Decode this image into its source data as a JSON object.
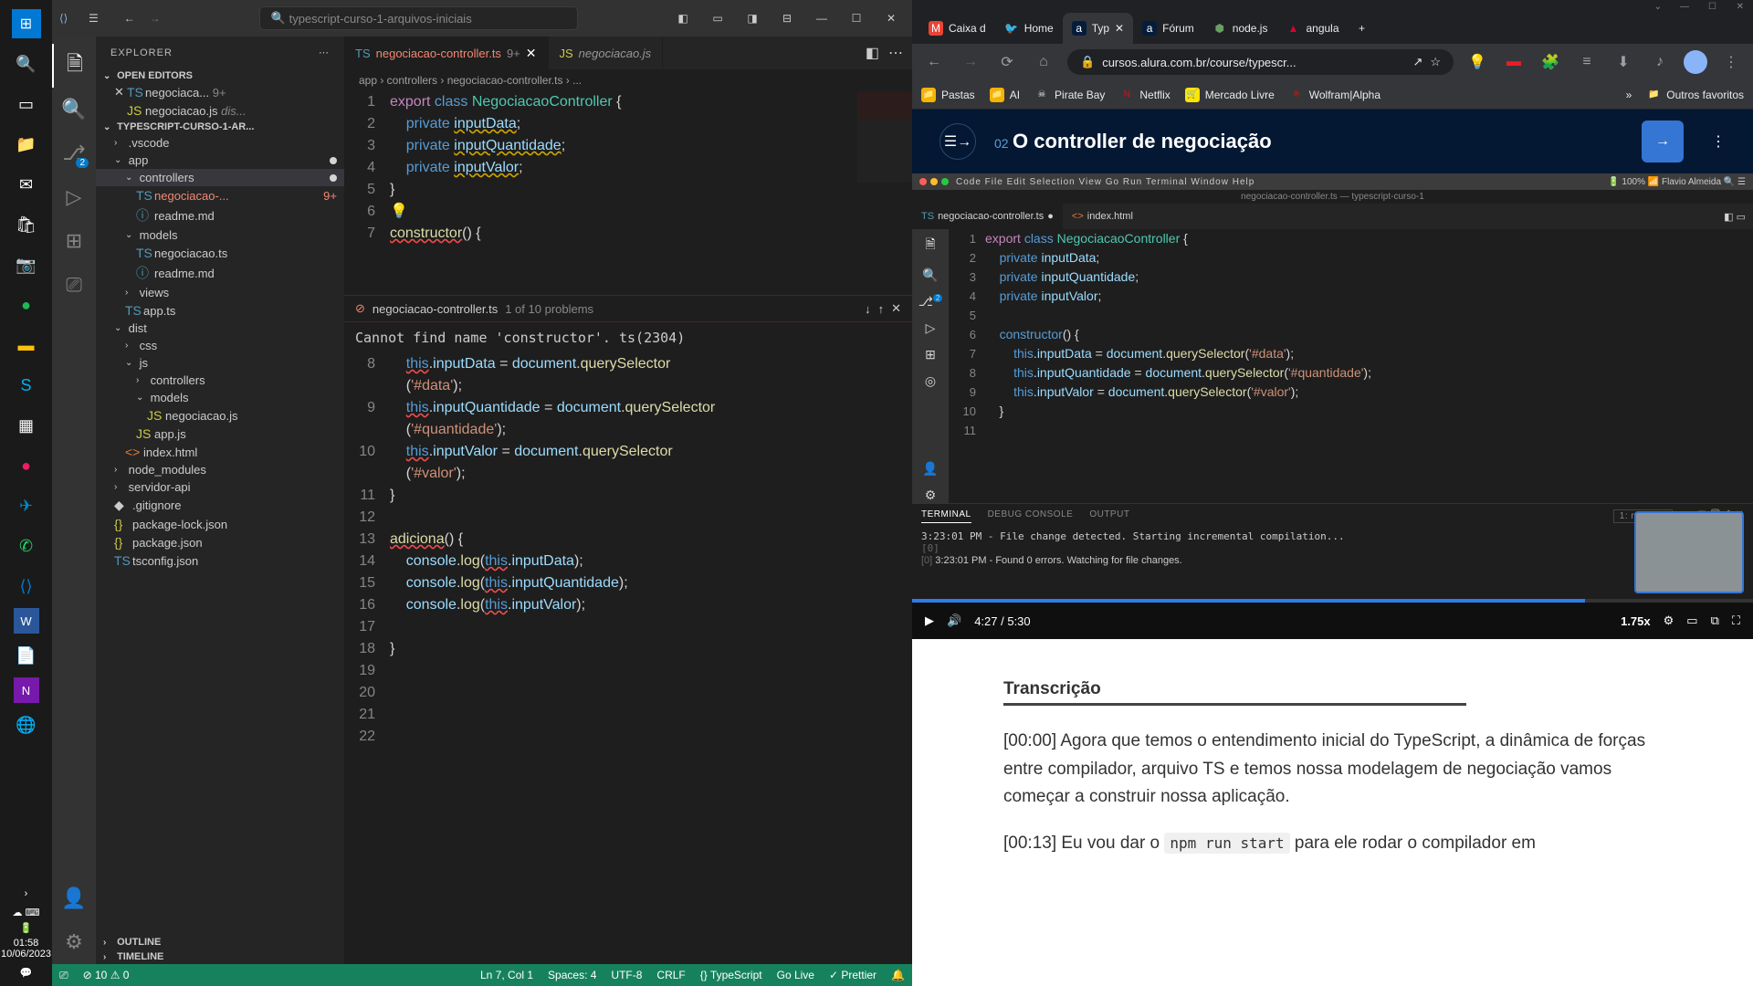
{
  "taskbar": {
    "time": "01:58",
    "date": "10/06/2023"
  },
  "vscode": {
    "titlebar_search": "typescript-curso-1-arquivos-iniciais",
    "explorer_label": "EXPLORER",
    "open_editors_label": "OPEN EDITORS",
    "workspace_label": "TYPESCRIPT-CURSO-1-AR...",
    "outline_label": "OUTLINE",
    "timeline_label": "TIMELINE",
    "editors": [
      {
        "name": "negociaca...",
        "badge": "9+",
        "icon": "TS"
      },
      {
        "name": "negociacao.js",
        "badge": "dis...",
        "icon": "JS"
      }
    ],
    "tree": {
      "vscode": ".vscode",
      "app": "app",
      "controllers": "controllers",
      "negociacao_ts": "negociacao-...",
      "negociacao_badge": "9+",
      "readme": "readme.md",
      "models": "models",
      "negociacao_model": "negociacao.ts",
      "readme2": "readme.md",
      "views": "views",
      "app_ts": "app.ts",
      "dist": "dist",
      "css": "css",
      "js": "js",
      "controllers2": "controllers",
      "models2": "models",
      "negociacao_js": "negociacao.js",
      "app_js": "app.js",
      "index_html": "index.html",
      "node_modules": "node_modules",
      "servidor_api": "servidor-api",
      "gitignore": ".gitignore",
      "package_lock": "package-lock.json",
      "package_json": "package.json",
      "tsconfig": "tsconfig.json"
    },
    "tabs": [
      {
        "name": "negociacao-controller.ts",
        "badge": "9+",
        "icon": "TS",
        "active": true
      },
      {
        "name": "negociacao.js",
        "icon": "JS",
        "active": false
      }
    ],
    "breadcrumb": "app › controllers › negociacao-controller.ts › ...",
    "problem": {
      "file": "negociacao-controller.ts",
      "count": "1 of 10 problems",
      "message": "Cannot find name 'constructor'. ts(2304)"
    },
    "statusbar": {
      "errors": "10",
      "warnings": "0",
      "ln_col": "Ln 7, Col 1",
      "spaces": "Spaces: 4",
      "encoding": "UTF-8",
      "eol": "CRLF",
      "lang": "TypeScript",
      "golive": "Go Live",
      "prettier": "Prettier"
    }
  },
  "browser": {
    "tabs": [
      {
        "label": "Caixa d",
        "icon_bg": "#ea4335"
      },
      {
        "label": "Home",
        "icon_bg": "#1da1f2"
      },
      {
        "label": "Typ",
        "icon_bg": "#051d3b",
        "active": true
      },
      {
        "label": "Fórum",
        "icon_bg": "#051d3b"
      },
      {
        "label": "node.js",
        "icon_bg": "#68a063"
      },
      {
        "label": "angula",
        "icon_bg": "#dd0031"
      }
    ],
    "url": "cursos.alura.com.br/course/typescr...",
    "bookmarks": [
      {
        "label": "Pastas",
        "color": "#f4b400"
      },
      {
        "label": "AI",
        "color": "#f4b400"
      },
      {
        "label": "Pirate Bay",
        "color": "#000"
      },
      {
        "label": "Netflix",
        "color": "#e50914"
      },
      {
        "label": "Mercado Livre",
        "color": "#ffe600"
      },
      {
        "label": "Wolfram|Alpha",
        "color": "#dd1100"
      }
    ],
    "bookmarks_more": "Outros favoritos"
  },
  "alura": {
    "lesson_num": "02",
    "title": "O controller de negociação",
    "video": {
      "menubar": "Code  File  Edit  Selection  View  Go  Run  Terminal  Window  Help",
      "battery": "100%",
      "user": "Flavio Almeida",
      "tab1": "negociacao-controller.ts",
      "tab2": "index.html",
      "breadcrumb": "negociacao-controller.ts — typescript-curso-1",
      "terminal_tabs": [
        "TERMINAL",
        "DEBUG CONSOLE",
        "OUTPUT"
      ],
      "terminal_dropdown": "1: node",
      "terminal_line1": "3:23:01 PM - File change detected. Starting incremental compilation...",
      "terminal_line2": "3:23:01 PM - Found 0 errors. Watching for file changes.",
      "time_current": "4:27",
      "time_total": "5:30",
      "speed": "1.75x"
    },
    "transcript": {
      "heading": "Transcrição",
      "p1": "[00:00] Agora que temos o entendimento inicial do TypeScript, a dinâmica de forças entre compilador, arquivo TS e temos nossa modelagem de negociação vamos começar a construir nossa aplicação.",
      "p2_before": "[00:13] Eu vou dar o ",
      "p2_code": "npm run start",
      "p2_after": " para ele rodar o compilador em"
    }
  }
}
